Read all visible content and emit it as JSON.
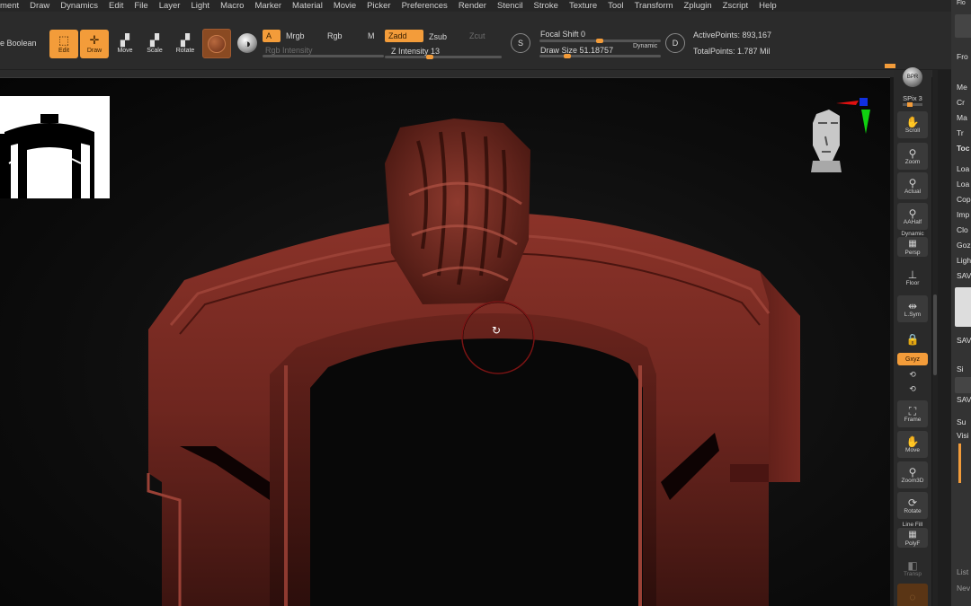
{
  "menu": [
    "ment",
    "Draw",
    "Dynamics",
    "Edit",
    "File",
    "Layer",
    "Light",
    "Macro",
    "Marker",
    "Material",
    "Movie",
    "Picker",
    "Preferences",
    "Render",
    "Stencil",
    "Stroke",
    "Texture",
    "Tool",
    "Transform",
    "Zplugin",
    "Zscript",
    "Help"
  ],
  "toolbar": {
    "live_boolean": "e Boolean",
    "edit": "Edit",
    "draw": "Draw",
    "move": "Move",
    "scale": "Scale",
    "rotate": "Rotate",
    "a": "A",
    "mrgb": "Mrgb",
    "rgb": "Rgb",
    "m": "M",
    "rgb_intensity": "Rgb Intensity",
    "zadd": "Zadd",
    "zsub": "Zsub",
    "zcut": "Zcut",
    "z_intensity_label": "Z Intensity",
    "z_intensity_value": "13",
    "focal_shift_label": "Focal Shift",
    "focal_shift_value": "0",
    "draw_size_label": "Draw Size",
    "draw_size_value": "51.18757",
    "dynamic": "Dynamic",
    "active_points": "ActivePoints: 893,167",
    "total_points": "TotalPoints: 1.787 Mil",
    "lazy_icon_letter": "S",
    "brush_icon_letter": "D"
  },
  "shelf": {
    "bpr": "BPR",
    "spix": "SPix 3",
    "scroll": "Scroll",
    "zoom": "Zoom",
    "actual": "Actual",
    "aahalf": "AAHalf",
    "dynamic": "Dynamic",
    "persp": "Persp",
    "floor": "Floor",
    "lsym": "L.Sym",
    "xyz": "Gxyz",
    "frame": "Frame",
    "move": "Move",
    "zoom3d": "Zoom3D",
    "rotate": "Rotate",
    "line_fill": "Line Fill",
    "polyf": "PolyF",
    "transp": "Transp"
  },
  "tray": {
    "items": [
      "Me",
      "Cr",
      "Ma",
      "Tr",
      "Toc",
      "Loa",
      "Loa",
      "Cop",
      "Imp",
      "Clo",
      "Goz",
      "Ligh",
      "SAV",
      "SAV",
      "Si",
      "SAV",
      "Su",
      "Visi",
      "List",
      "Nev"
    ],
    "top_label": "Flo",
    "from": "Fro"
  },
  "colors": {
    "accent": "#f39c3a",
    "panel": "#2b2b2b",
    "model_red": "#7a2a22"
  }
}
